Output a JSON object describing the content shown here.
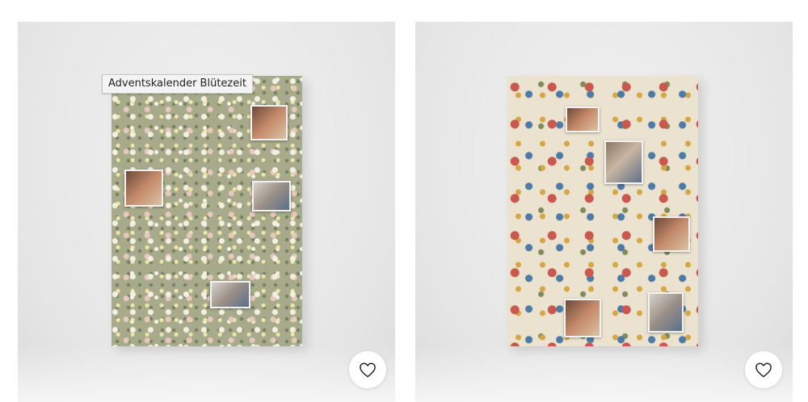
{
  "tooltip": {
    "text": "Adventskalender Blütezeit"
  },
  "products": [
    {
      "pattern": "green floral",
      "favorite_icon": "heart-icon"
    },
    {
      "pattern": "cream floral",
      "favorite_icon": "heart-icon"
    }
  ],
  "colors": {
    "card_bg": "#e6e6e6",
    "calendar_1_bg": "#a8ab8b",
    "calendar_2_bg": "#ebe3cf"
  }
}
